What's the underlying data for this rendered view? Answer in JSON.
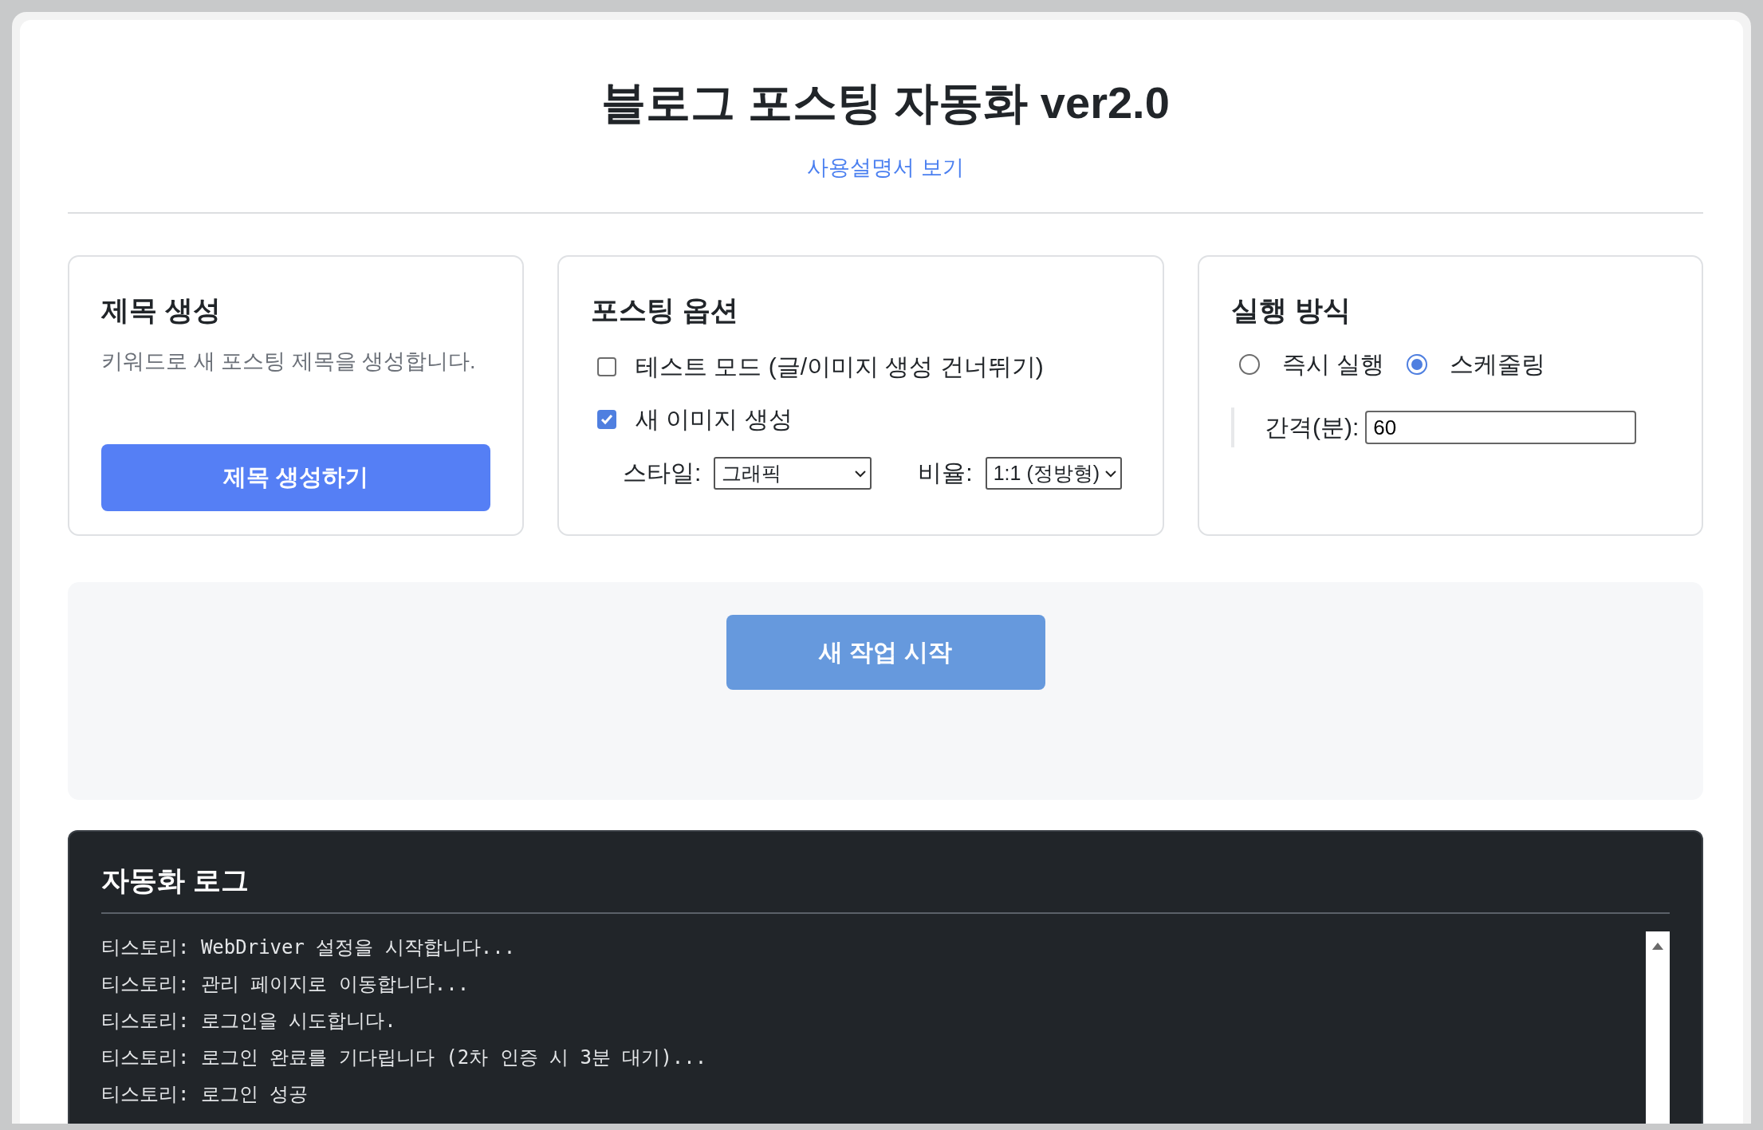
{
  "title": "블로그 포스팅 자동화 ver2.0",
  "manual_link": "사용설명서 보기",
  "title_card": {
    "title": "제목 생성",
    "description": "키워드로 새 포스팅 제목을 생성합니다.",
    "button": "제목 생성하기"
  },
  "options_card": {
    "title": "포스팅 옵션",
    "checkboxes": [
      {
        "label": "테스트 모드 (글/이미지 생성 건너뛰기)",
        "checked": false
      },
      {
        "label": "새 이미지 생성",
        "checked": true
      }
    ],
    "selects": [
      {
        "label": "스타일:",
        "value": "그래픽"
      },
      {
        "label": "비율:",
        "value": "1:1 (정방형)"
      }
    ]
  },
  "run_card": {
    "title": "실행 방식",
    "radios": [
      {
        "label": "즉시 실행",
        "selected": false
      },
      {
        "label": "스케줄링",
        "selected": true
      }
    ],
    "interval": {
      "label": "간격(분):",
      "value": "60"
    }
  },
  "start_button": "새 작업 시작",
  "log": {
    "title": "자동화 로그",
    "lines": [
      "티스토리: WebDriver 설정을 시작합니다...",
      "티스토리: 관리 페이지로 이동합니다...",
      "티스토리: 로그인을 시도합니다.",
      "티스토리: 로그인 완료를 기다립니다 (2차 인증 시 3분 대기)...",
      "티스토리: 로그인 성공"
    ]
  }
}
